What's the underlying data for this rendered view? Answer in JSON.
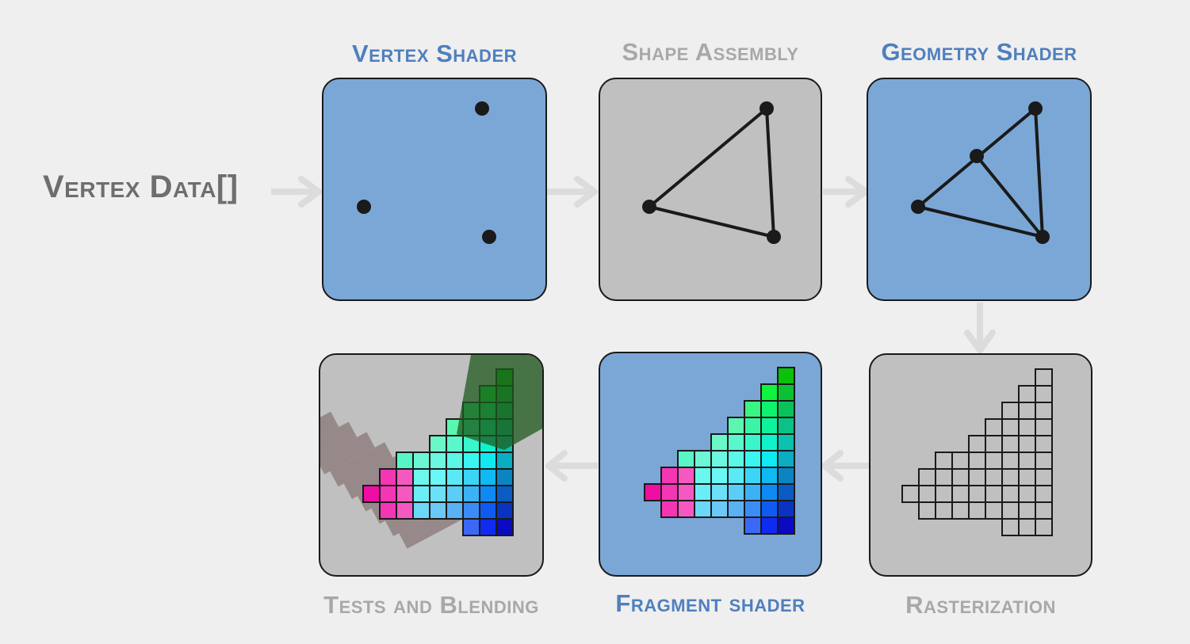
{
  "input_label": "Vertex Data[]",
  "stages": [
    {
      "id": "vertex-shader",
      "label": "Vertex Shader",
      "kind": "shader"
    },
    {
      "id": "shape-assembly",
      "label": "Shape Assembly",
      "kind": "fixed"
    },
    {
      "id": "geometry-shader",
      "label": "Geometry Shader",
      "kind": "shader"
    },
    {
      "id": "rasterization",
      "label": "Rasterization",
      "kind": "fixed"
    },
    {
      "id": "fragment-shader",
      "label": "Fragment shader",
      "kind": "shader"
    },
    {
      "id": "tests-and-blending",
      "label": "Tests and Blending",
      "kind": "fixed"
    }
  ],
  "colors": {
    "shader_fill": "#7ba7d7",
    "fixed_fill": "#c0c0c0",
    "shader_label": "#4f7fbe",
    "fixed_label": "#a8a8a8",
    "arrow": "#dcdcdc"
  }
}
